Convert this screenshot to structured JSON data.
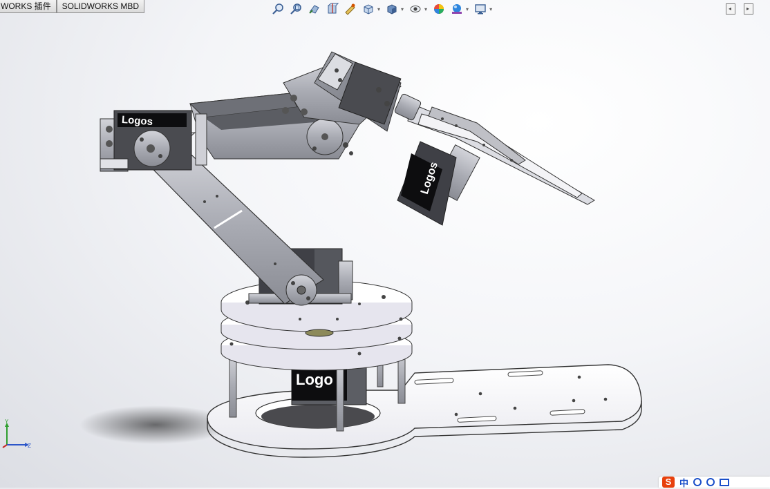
{
  "tabs": [
    {
      "label": "WORKS 插件"
    },
    {
      "label": "SOLIDWORKS MBD"
    }
  ],
  "toolbar": {
    "icons": [
      "zoom-to-fit-icon",
      "zoom-area-icon",
      "previous-view-icon",
      "section-view-icon",
      "dynamic-annotation-icon",
      "view-orientation-icon",
      "display-style-icon",
      "hide-show-icon",
      "edit-appearance-icon",
      "apply-scene-icon",
      "view-settings-icon"
    ]
  },
  "model": {
    "logo_text": "Logos",
    "logo_text_base": "Logo"
  },
  "triad": {
    "y_label": "Y",
    "z_label": "Z"
  },
  "ime": {
    "brand": "S",
    "lang": "中"
  }
}
